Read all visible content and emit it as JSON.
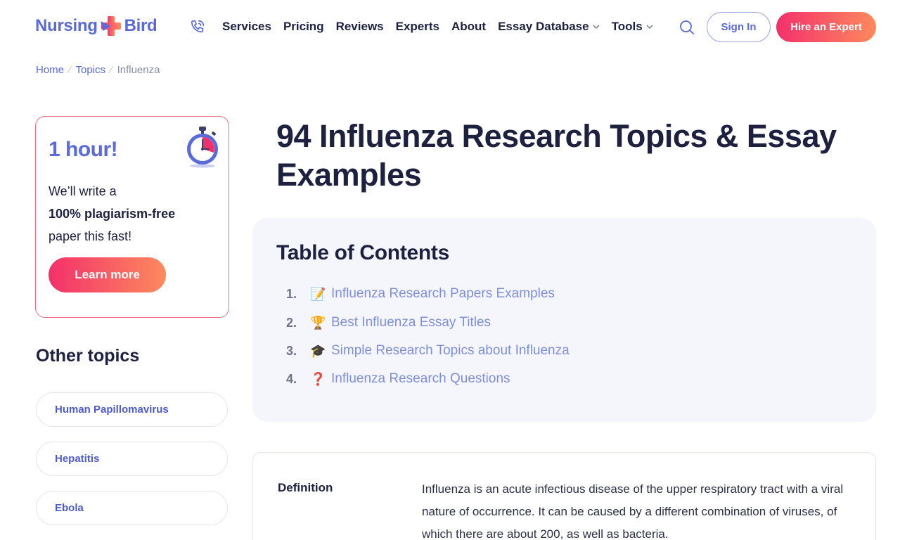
{
  "header": {
    "logo": {
      "part1": "Nursing",
      "part2": "Bird"
    },
    "nav": [
      {
        "label": "Services",
        "dropdown": false
      },
      {
        "label": "Pricing",
        "dropdown": false
      },
      {
        "label": "Reviews",
        "dropdown": false
      },
      {
        "label": "Experts",
        "dropdown": false
      },
      {
        "label": "About",
        "dropdown": false
      },
      {
        "label": "Essay Database",
        "dropdown": true
      },
      {
        "label": "Tools",
        "dropdown": true
      }
    ],
    "sign_in": "Sign In",
    "hire": "Hire an Expert",
    "accent": "#5a6ad8",
    "gradient_start": "#f4306b",
    "gradient_end": "#fd8a5e"
  },
  "breadcrumb": {
    "items": [
      "Home",
      "Topics"
    ],
    "current": "Influenza"
  },
  "promo": {
    "title": "1 hour!",
    "line1": "We’ll write a",
    "line2": "100% plagiarism-free",
    "line3": "paper this fast!",
    "button": "Learn more",
    "icon": "stopwatch-icon"
  },
  "other_topics": {
    "title": "Other topics",
    "items": [
      "Human Papillomavirus",
      "Hepatitis",
      "Ebola"
    ]
  },
  "main": {
    "title": "94 Influenza Research Topics & Essay Examples",
    "toc": {
      "title": "Table of Contents",
      "items": [
        {
          "num": "1.",
          "emoji": "📝",
          "label": "Influenza Research Papers Examples"
        },
        {
          "num": "2.",
          "emoji": "🏆",
          "label": "Best Influenza Essay Titles"
        },
        {
          "num": "3.",
          "emoji": "🎓",
          "label": "Simple Research Topics about Influenza"
        },
        {
          "num": "4.",
          "emoji": "❓",
          "label": "Influenza Research Questions"
        }
      ]
    },
    "definition": {
      "label": "Definition",
      "text": "Influenza is an acute infectious disease of the upper respiratory tract with a viral nature of occurrence. It can be caused by a different combination of viruses, of which there are about 200, as well as bacteria."
    }
  }
}
